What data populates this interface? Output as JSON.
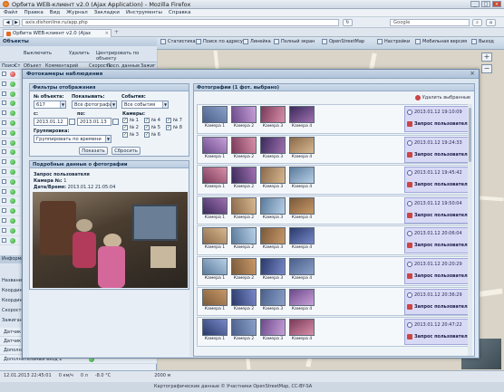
{
  "browser": {
    "title": "Орбита WEB-клиент v2.0 (Ajax Application) - Mozilla Firefox",
    "menu": [
      "Файл",
      "Правка",
      "Вид",
      "Журнал",
      "Закладки",
      "Инструменты",
      "Справка"
    ],
    "url": "axis.dishonline.ru/app.php",
    "search_placeholder": "Google",
    "tab_label": "Орбита WEB-клиент v2.0 (Ajax Application)"
  },
  "appbar": {
    "items": [
      "Выключить",
      "Удалить",
      "Центрировать по объекту",
      "Статистика",
      "Поиск по адресу",
      "Линейка",
      "Полный экран",
      "OpenStreetMap",
      "Настройки",
      "Мобильная версия",
      "Выход"
    ]
  },
  "objects": {
    "title": "Объекты",
    "toolbar": [
      "Выключить",
      "Удалить",
      "Центрировать по объекту"
    ],
    "columns": [
      "Поиск",
      "Ст",
      "Объект",
      "Комментарий",
      "Скорость",
      "Посл. данные",
      "Зажиг"
    ]
  },
  "info": {
    "tab": "Информация",
    "rows": [
      "Название",
      "Координаты",
      "Координаты",
      "Скорость",
      "Зажигание"
    ]
  },
  "sensors": [
    {
      "label": "Датчик открытия двери",
      "state": "red"
    },
    {
      "label": "Датчик крышки бензобака",
      "state": "green"
    },
    {
      "label": "Дополнительный вход 1",
      "state": "red"
    },
    {
      "label": "Дополнительный вход 2",
      "state": "green"
    },
    {
      "label": "Тревожная кнопка",
      "state": "green"
    }
  ],
  "status": {
    "date": "12.01.2013 22:45:01",
    "speed": "0 км/ч",
    "fuel": "0 л",
    "temp": "-8.0 °C",
    "copyright": "Картографические данные © Участники OpenStreetMap, CC-BY-SA",
    "scale": "2000 м"
  },
  "modal": {
    "title": "Фотокамеры наблюдения",
    "filters": {
      "title": "Фильтры отображения",
      "object_label": "№ объекта:",
      "object_value": "617",
      "show_label": "Показывать:",
      "show_value": "Все фотографии",
      "events_label": "События:",
      "events_value": "Все события",
      "from_label": "с:",
      "from_value": "2013.01.12",
      "to_label": "по:",
      "to_value": "2013.01.13",
      "cameras_label": "Камеры:",
      "cameras": [
        "№ 1",
        "№ 4",
        "№ 7",
        "№ 2",
        "№ 5",
        "№ 8",
        "№ 3",
        "№ 6"
      ],
      "group_label": "Группировка:",
      "group_value": "Группировать по времени",
      "show_btn": "Показать",
      "reset_btn": "Сбросить"
    },
    "details": {
      "title": "Подробные данные о фотографии",
      "line1": "Запрос пользователя",
      "camera_label": "Камера №:",
      "camera_value": "1",
      "datetime_label": "Дата/Время:",
      "datetime_value": "2013.01.12 21:05:04"
    },
    "photos": {
      "title": "Фотографии (1 фот. выбрано)",
      "delete_selected": "Удалить выбранные",
      "camera_labels": [
        "Камера 1",
        "Камера 2",
        "Камера 3",
        "Камера 4"
      ],
      "rows": [
        {
          "date": "2013.01.12 19:10:09",
          "event": "Запрос пользователя"
        },
        {
          "date": "2013.01.12 19:24:33",
          "event": "Запрос пользователя"
        },
        {
          "date": "2013.01.12 19:45:42",
          "event": "Запрос пользователя"
        },
        {
          "date": "2013.01.12 19:50:04",
          "event": "Запрос пользователя"
        },
        {
          "date": "2013.01.12 20:06:04",
          "event": "Запрос пользователя"
        },
        {
          "date": "2013.01.12 20:20:29",
          "event": "Запрос пользователя"
        },
        {
          "date": "2013.01.12 20:36:29",
          "event": "Запрос пользователя"
        },
        {
          "date": "2013.01.12 20:47:22",
          "event": "Запрос пользователя"
        }
      ]
    }
  }
}
